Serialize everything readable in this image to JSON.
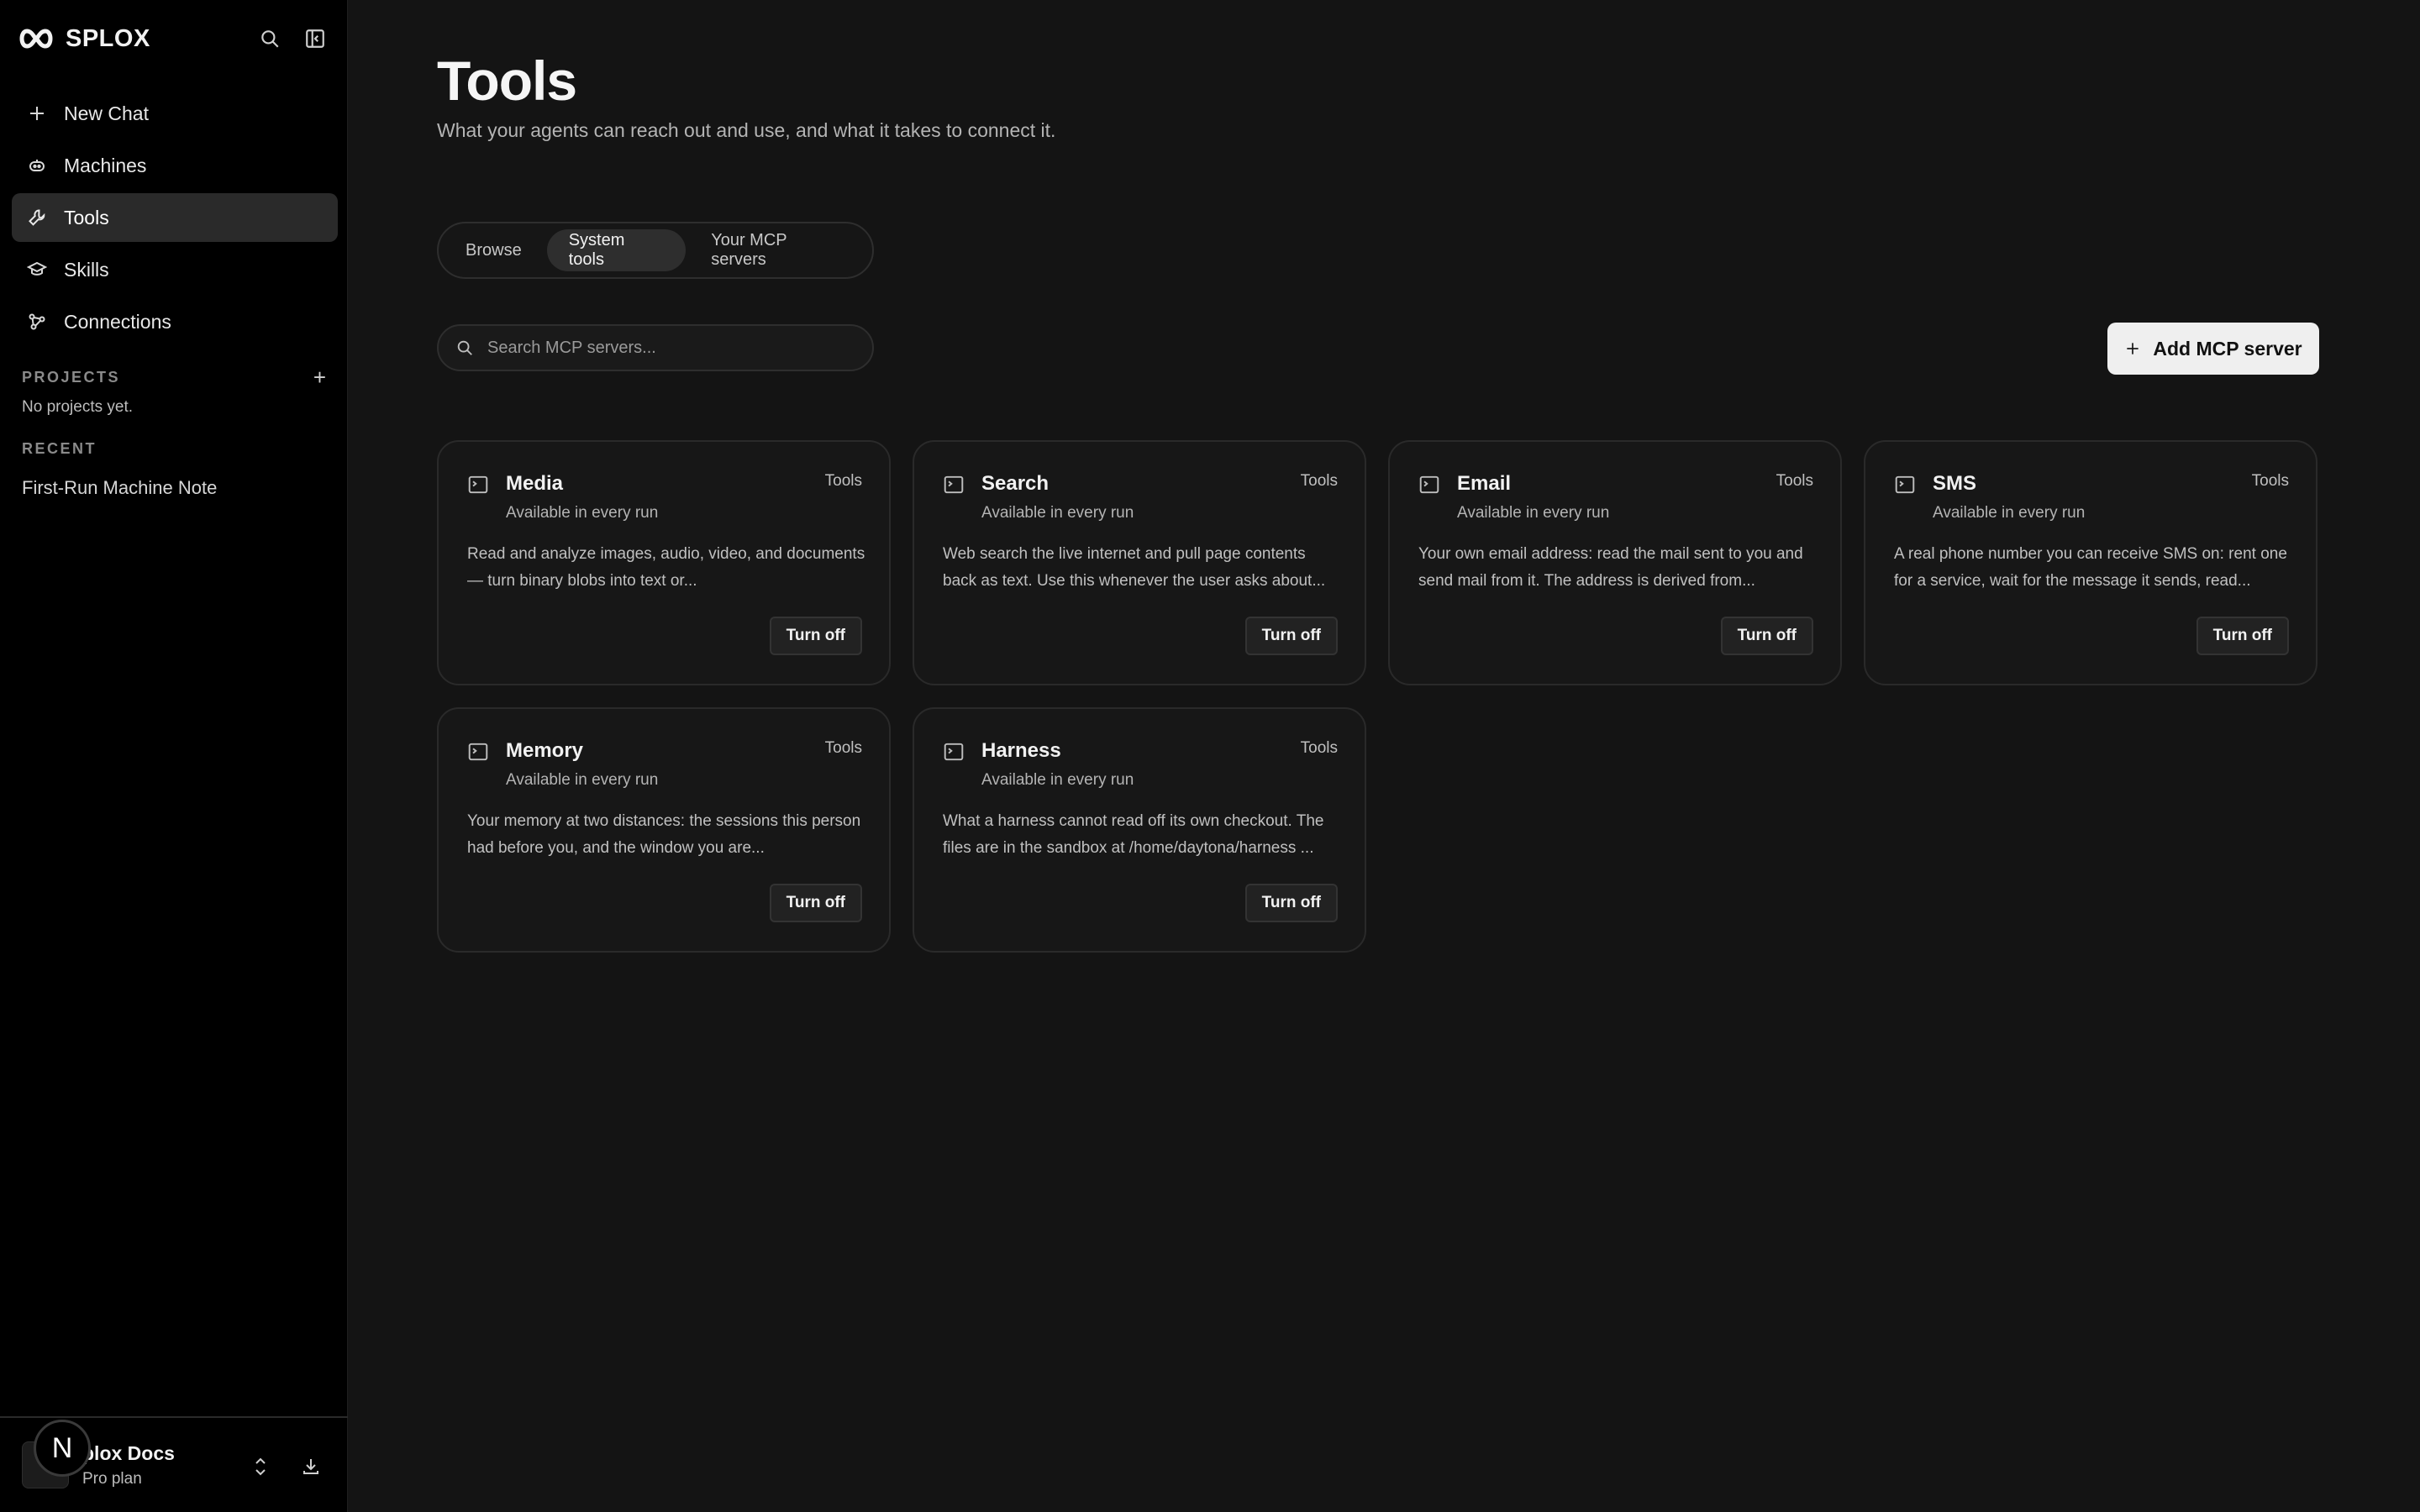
{
  "sidebar": {
    "brand": "SPLOX",
    "nav": [
      {
        "label": "New Chat",
        "icon": "plus-icon"
      },
      {
        "label": "Machines",
        "icon": "robot-icon"
      },
      {
        "label": "Tools",
        "icon": "wrench-icon",
        "active": true
      },
      {
        "label": "Skills",
        "icon": "graduation-cap-icon"
      },
      {
        "label": "Connections",
        "icon": "nodes-icon"
      }
    ],
    "projects_heading": "PROJECTS",
    "projects_empty": "No projects yet.",
    "recent_heading": "RECENT",
    "recent_items": [
      "First-Run Machine Note"
    ],
    "workspace": {
      "name": "Splox Docs",
      "name_visible": "plox Docs",
      "plan": "Pro plan",
      "badge": "N"
    }
  },
  "main": {
    "title": "Tools",
    "subtitle": "What your agents can reach out and use, and what it takes to connect it.",
    "tabs": [
      {
        "label": "Browse"
      },
      {
        "label": "System tools",
        "active": true
      },
      {
        "label": "Your MCP servers"
      }
    ],
    "search": {
      "placeholder": "Search MCP servers..."
    },
    "add_button": "Add MCP server",
    "cards": [
      {
        "title": "Media",
        "tag": "Tools",
        "availability": "Available in every run",
        "description": "Read and analyze images, audio, video, and documents — turn binary blobs into text or...",
        "action": "Turn off"
      },
      {
        "title": "Search",
        "tag": "Tools",
        "availability": "Available in every run",
        "description": "Web search the live internet and pull page contents back as text. Use this whenever the user asks about...",
        "action": "Turn off"
      },
      {
        "title": "Email",
        "tag": "Tools",
        "availability": "Available in every run",
        "description": "Your own email address: read the mail sent to you and send mail from it. The address is derived from...",
        "action": "Turn off"
      },
      {
        "title": "SMS",
        "tag": "Tools",
        "availability": "Available in every run",
        "description": "A real phone number you can receive SMS on: rent one for a service, wait for the message it sends, read...",
        "action": "Turn off"
      },
      {
        "title": "Memory",
        "tag": "Tools",
        "availability": "Available in every run",
        "description": "Your memory at two distances: the sessions this person had before you, and the window you are...",
        "action": "Turn off"
      },
      {
        "title": "Harness",
        "tag": "Tools",
        "availability": "Available in every run",
        "description": "What a harness cannot read off its own checkout. The files are in the sandbox at /home/daytona/harness ...",
        "action": "Turn off"
      }
    ]
  }
}
